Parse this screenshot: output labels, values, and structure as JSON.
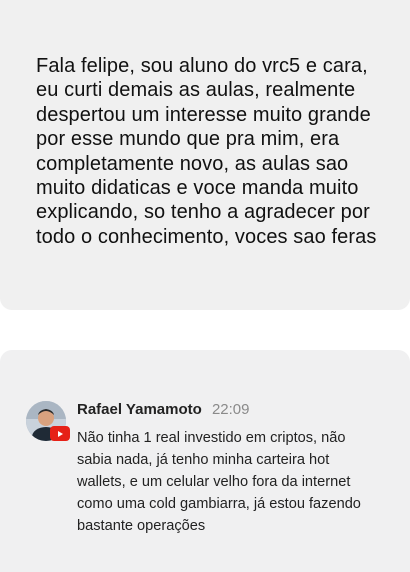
{
  "message": {
    "text": "Fala felipe, sou aluno do vrc5 e cara,\neu curti demais as aulas, realmente\ndespertou um interesse muito grande\npor esse mundo que pra mim, era\ncompletamente novo, as aulas sao\nmuito didaticas e voce manda muito\nexplicando, so tenho a agradecer por\ntodo o conhecimento, voces sao feras"
  },
  "comment": {
    "author": "Rafael Yamamoto",
    "time": "22:09",
    "text": "Não tinha 1 real investido em criptos, não\nsabia nada, já tenho minha carteira hot\nwallets, e um celular velho fora da internet\ncomo uma cold gambiarra, já estou fazendo\nbastante operações",
    "avatar_icon": "user-avatar",
    "badge_icon": "youtube-icon",
    "badge_color": "#e62117"
  }
}
